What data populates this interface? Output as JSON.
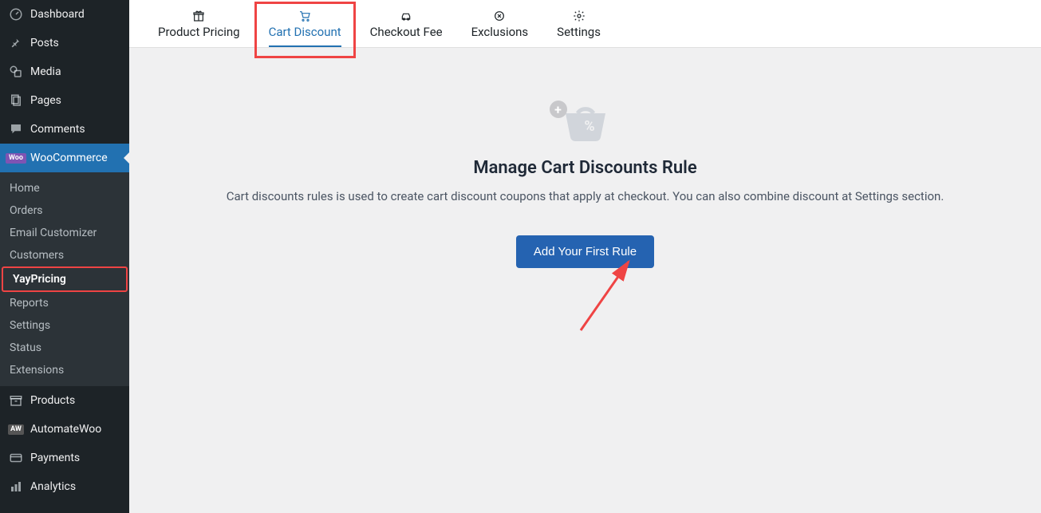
{
  "sidebar": {
    "items": [
      {
        "label": "Dashboard",
        "icon": "dashboard"
      },
      {
        "label": "Posts",
        "icon": "pin"
      },
      {
        "label": "Media",
        "icon": "media"
      },
      {
        "label": "Pages",
        "icon": "pages"
      },
      {
        "label": "Comments",
        "icon": "comment"
      },
      {
        "label": "WooCommerce",
        "icon": "woo",
        "active": true
      },
      {
        "label": "Products",
        "icon": "archive"
      },
      {
        "label": "AutomateWoo",
        "icon": "aw"
      },
      {
        "label": "Payments",
        "icon": "card"
      },
      {
        "label": "Analytics",
        "icon": "chart"
      }
    ],
    "sub": [
      {
        "label": "Home"
      },
      {
        "label": "Orders"
      },
      {
        "label": "Email Customizer"
      },
      {
        "label": "Customers"
      },
      {
        "label": "YayPricing",
        "current": true,
        "highlight": true
      },
      {
        "label": "Reports"
      },
      {
        "label": "Settings"
      },
      {
        "label": "Status"
      },
      {
        "label": "Extensions"
      }
    ]
  },
  "tabs": [
    {
      "label": "Product Pricing",
      "icon": "gift"
    },
    {
      "label": "Cart Discount",
      "icon": "cart",
      "active": true,
      "highlight": true
    },
    {
      "label": "Checkout Fee",
      "icon": "car"
    },
    {
      "label": "Exclusions",
      "icon": "close-circle"
    },
    {
      "label": "Settings",
      "icon": "gear"
    }
  ],
  "main": {
    "heading": "Manage Cart Discounts Rule",
    "description": "Cart discounts rules is used to create cart discount coupons that apply at checkout. You can also combine discount at Settings section.",
    "cta_label": "Add Your First Rule",
    "plus_glyph": "+"
  },
  "woo_badge": "Woo",
  "aw_badge": "AW"
}
